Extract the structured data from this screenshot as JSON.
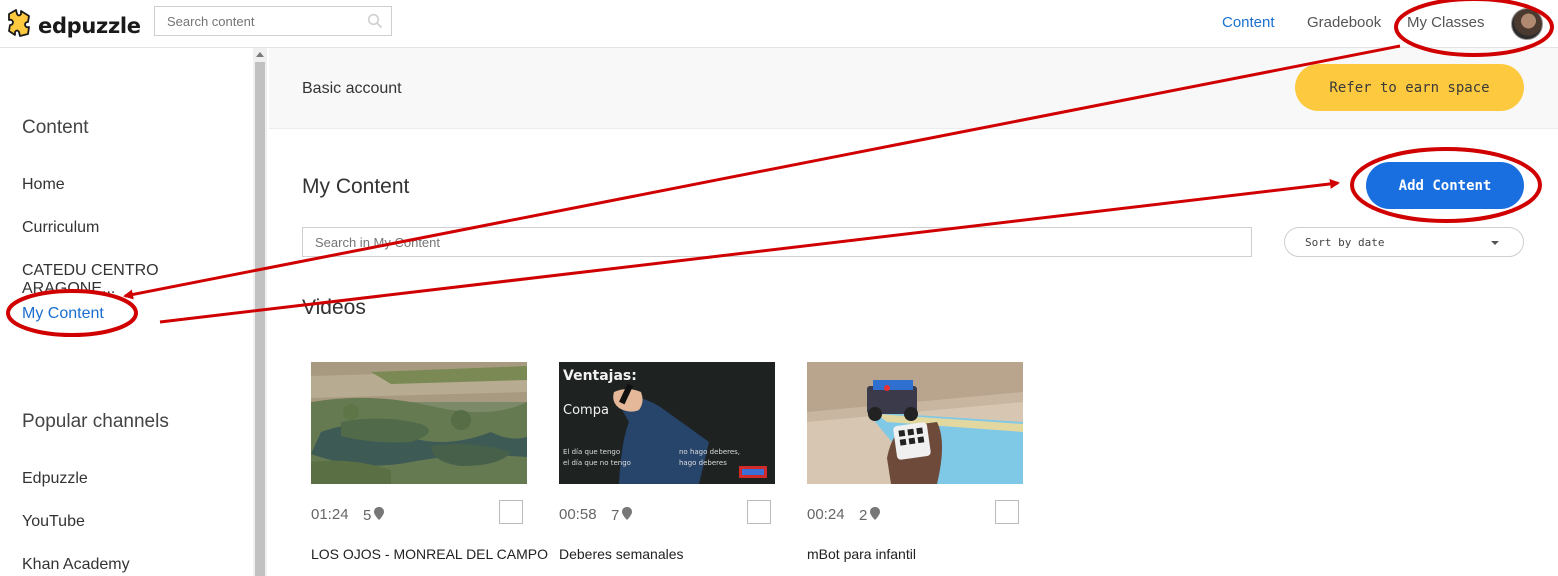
{
  "app": {
    "name": "edpuzzle"
  },
  "header": {
    "search_placeholder": "Search content",
    "nav": [
      {
        "label": "Content",
        "active": true
      },
      {
        "label": "Gradebook",
        "active": false
      },
      {
        "label": "My Classes",
        "active": false
      }
    ]
  },
  "sidebar": {
    "content_heading": "Content",
    "items": [
      {
        "label": "Home"
      },
      {
        "label": "Curriculum"
      },
      {
        "label": "CATEDU CENTRO ARAGONE..."
      },
      {
        "label": "My Content",
        "active": true
      }
    ],
    "channels_heading": "Popular channels",
    "channels": [
      {
        "label": "Edpuzzle"
      },
      {
        "label": "YouTube"
      },
      {
        "label": "Khan Academy"
      }
    ]
  },
  "banner": {
    "account_text": "Basic account",
    "refer_label": "Refer to earn space"
  },
  "main": {
    "title": "My Content",
    "add_label": "Add Content",
    "search_placeholder": "Search in My Content",
    "sort_label": "Sort by date",
    "section_heading": "Videos",
    "videos": [
      {
        "duration": "01:24",
        "questions": "5",
        "title": "LOS OJOS - MONREAL DEL CAMPO",
        "thumb": "aerial-landscape"
      },
      {
        "duration": "00:58",
        "questions": "7",
        "title": "Deberes semanales",
        "thumb": "chalkboard"
      },
      {
        "duration": "00:24",
        "questions": "2",
        "title": "mBot para infantil",
        "thumb": "robot-remote"
      }
    ]
  },
  "thumb_text": {
    "board_title": "Ventajas:",
    "board_word": "Compa",
    "board_line1": "El día que tengo",
    "board_line1b": "no hago deberes,",
    "board_line2": "el día que no tengo",
    "board_line2b": "hago deberes"
  },
  "colors": {
    "accent": "#1a6fe0",
    "refer": "#fcc93f",
    "annotation": "#d10000"
  }
}
